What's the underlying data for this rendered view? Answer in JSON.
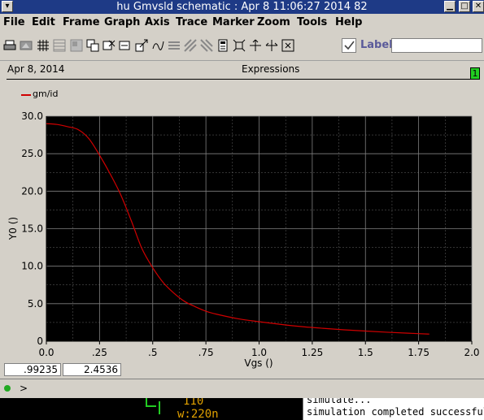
{
  "window": {
    "title": "hu Gmvsld schematic : Apr  8 11:06:27 2014 82"
  },
  "menu": [
    "File",
    "Edit",
    "Frame",
    "Graph",
    "Axis",
    "Trace",
    "Marker",
    "Zoom",
    "Tools",
    "Help"
  ],
  "toolbar": {
    "icons": [
      "print-icon",
      "print-preview-icon",
      "grid-icon",
      "strip-icon",
      "subwindow-icon",
      "copy-icon",
      "delete-icon",
      "move-icon",
      "label-icon",
      "display-icon",
      "hatch-icon",
      "hatch-alt-icon",
      "calculator-icon",
      "fit-icon",
      "zoom-x-icon",
      "zoom-y-icon",
      "zoom-fit-icon"
    ],
    "label_text": "Label",
    "label_input_value": ""
  },
  "panel": {
    "date": "Apr 8, 2014",
    "expressions": "Expressions",
    "page_number": "1"
  },
  "colors": {
    "trace": "#d00000",
    "grid": "#808080",
    "plot_bg": "#000000"
  },
  "chart_data": {
    "type": "line",
    "title": "",
    "xlabel": "Vgs ()",
    "ylabel": "Y0 ()",
    "xlim": [
      0,
      2.0
    ],
    "ylim": [
      0,
      30.0
    ],
    "x_ticks": [
      "0.0",
      ".25",
      ".5",
      ".75",
      "1.0",
      "1.25",
      "1.5",
      "1.75",
      "2.0"
    ],
    "y_ticks": [
      "0",
      "5.0",
      "10.0",
      "15.0",
      "20.0",
      "25.0",
      "30.0"
    ],
    "grid": true,
    "legend_position": "top-left",
    "series": [
      {
        "name": "gm/id",
        "x": [
          0.0,
          0.05,
          0.1,
          0.15,
          0.2,
          0.25,
          0.3,
          0.35,
          0.4,
          0.45,
          0.5,
          0.55,
          0.6,
          0.65,
          0.7,
          0.75,
          0.8,
          0.9,
          1.0,
          1.1,
          1.2,
          1.3,
          1.4,
          1.5,
          1.6,
          1.7,
          1.8
        ],
        "y": [
          29.0,
          28.9,
          28.6,
          28.2,
          27.0,
          24.8,
          22.3,
          19.5,
          16.0,
          12.3,
          9.8,
          7.8,
          6.4,
          5.3,
          4.6,
          4.0,
          3.6,
          3.0,
          2.6,
          2.25,
          1.95,
          1.72,
          1.52,
          1.35,
          1.2,
          1.07,
          0.95
        ]
      }
    ]
  },
  "status": {
    "coord_x": ".99235",
    "coord_y": "2.4536",
    "prompt": ">"
  },
  "schematic": {
    "line1": "110",
    "line2": "w:220n"
  },
  "log": {
    "line1": "simulate...",
    "line2": "simulation completed successful"
  }
}
